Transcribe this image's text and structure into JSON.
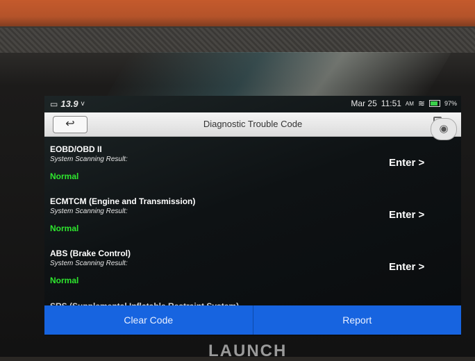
{
  "status_bar": {
    "voltage": "13.9",
    "voltage_unit": "v",
    "date": "Mar 25",
    "time": "11:51",
    "ampm": "AM",
    "battery_percent": "97%"
  },
  "header": {
    "back_icon": "back-arrow-icon",
    "title": "Diagnostic Trouble Code"
  },
  "results": [
    {
      "name": "EOBD/OBD II",
      "label": "System Scanning Result:",
      "status": "Normal",
      "action": "Enter >"
    },
    {
      "name": "ECMTCM (Engine and Transmission)",
      "label": "System Scanning Result:",
      "status": "Normal",
      "action": "Enter >"
    },
    {
      "name": "ABS (Brake Control)",
      "label": "System Scanning Result:",
      "status": "Normal",
      "action": "Enter >"
    }
  ],
  "partial_item": "SRS (Supplemental Inflatable Restraint System)",
  "footer": {
    "clear_code": "Clear Code",
    "report": "Report"
  },
  "device_brand": "LAUNCH",
  "colors": {
    "status_normal": "#2ee62e",
    "footer_blue": "#1764e0"
  }
}
